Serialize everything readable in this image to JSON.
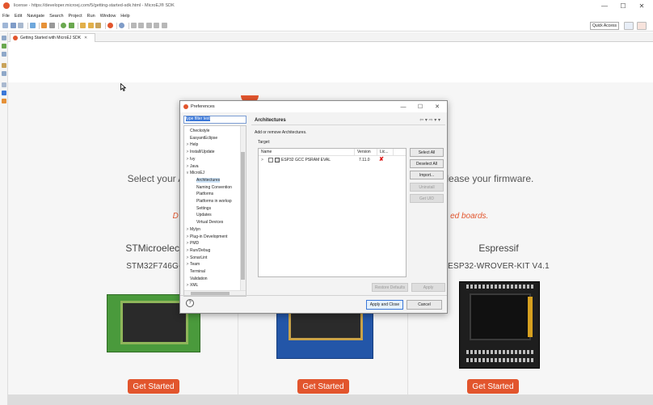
{
  "window": {
    "title": "license - https://developer.microej.com/5/getting-started-sdk.html - MicroEJ® SDK",
    "min_glyph": "—",
    "max_glyph": "☐",
    "close_glyph": "✕"
  },
  "menubar": [
    "File",
    "Edit",
    "Navigate",
    "Search",
    "Project",
    "Run",
    "Window",
    "Help"
  ],
  "toolbar": {
    "quick_access": "Quick Access"
  },
  "editor": {
    "tab_label": "Getting Started with MicroEJ SDK",
    "tab_close": "✕"
  },
  "webpage": {
    "select_text": "Select your Arch                                                                                    nd release your firmware.",
    "subtext": "D                                                                                                                         ed boards.",
    "columns": [
      {
        "vendor": "STMicroelectron",
        "board": "STM32F746G-DIS",
        "button": "Get Started"
      },
      {
        "vendor": "",
        "board": "",
        "button": "Get Started"
      },
      {
        "vendor": "Espressif",
        "board": "ESP32-WROVER-KIT V4.1",
        "button": "Get Started"
      }
    ]
  },
  "dialog": {
    "title": "Preferences",
    "filter_text": "type filter text",
    "tree": [
      {
        "label": "Checkstyle",
        "arrow": "",
        "level": 1
      },
      {
        "label": "EasyantEclipse",
        "arrow": "",
        "level": 1
      },
      {
        "label": "Help",
        "arrow": ">",
        "level": 1
      },
      {
        "label": "Install/Update",
        "arrow": ">",
        "level": 1
      },
      {
        "label": "Ivy",
        "arrow": ">",
        "level": 1
      },
      {
        "label": "Java",
        "arrow": ">",
        "level": 1
      },
      {
        "label": "MicroEJ",
        "arrow": "v",
        "level": 1
      },
      {
        "label": "Architectures",
        "arrow": "",
        "level": 2,
        "selected": true
      },
      {
        "label": "Naming Convention",
        "arrow": "",
        "level": 2
      },
      {
        "label": "Platforms",
        "arrow": "",
        "level": 2
      },
      {
        "label": "Platforms in worksp",
        "arrow": "",
        "level": 2
      },
      {
        "label": "Settings",
        "arrow": "",
        "level": 2
      },
      {
        "label": "Updates",
        "arrow": "",
        "level": 2
      },
      {
        "label": "Virtual Devices",
        "arrow": "",
        "level": 2
      },
      {
        "label": "Mylyn",
        "arrow": ">",
        "level": 1
      },
      {
        "label": "Plug-in Development",
        "arrow": ">",
        "level": 1
      },
      {
        "label": "PMD",
        "arrow": ">",
        "level": 1
      },
      {
        "label": "Run/Debug",
        "arrow": ">",
        "level": 1
      },
      {
        "label": "SonarLint",
        "arrow": ">",
        "level": 1
      },
      {
        "label": "Team",
        "arrow": ">",
        "level": 1
      },
      {
        "label": "Terminal",
        "arrow": "",
        "level": 1
      },
      {
        "label": "Validation",
        "arrow": "",
        "level": 1
      },
      {
        "label": "XML",
        "arrow": ">",
        "level": 1
      }
    ],
    "page_title": "Architectures",
    "page_nav": "⇦ ▾ ⇨ ▾ ▾",
    "page_desc": "Add or remove Architectures.",
    "target_label": "Target:",
    "table": {
      "headers": [
        "Name",
        "Version",
        "Lic..."
      ],
      "row": {
        "arrow": ">",
        "name": "ESP32 GCC PSRAM  EVAL",
        "version": "7.11.0",
        "license": "✘"
      }
    },
    "buttons": {
      "select_all": "Select All",
      "deselect_all": "Deselect All",
      "import": "Import...",
      "uninstall": "Uninstall",
      "get_uid": "Get UID",
      "restore_defaults": "Restore Defaults",
      "apply": "Apply",
      "apply_and_close": "Apply and Close",
      "cancel": "Cancel",
      "help": "?"
    }
  },
  "colors": {
    "accent": "#e2552d",
    "selection": "#3b78d8"
  }
}
